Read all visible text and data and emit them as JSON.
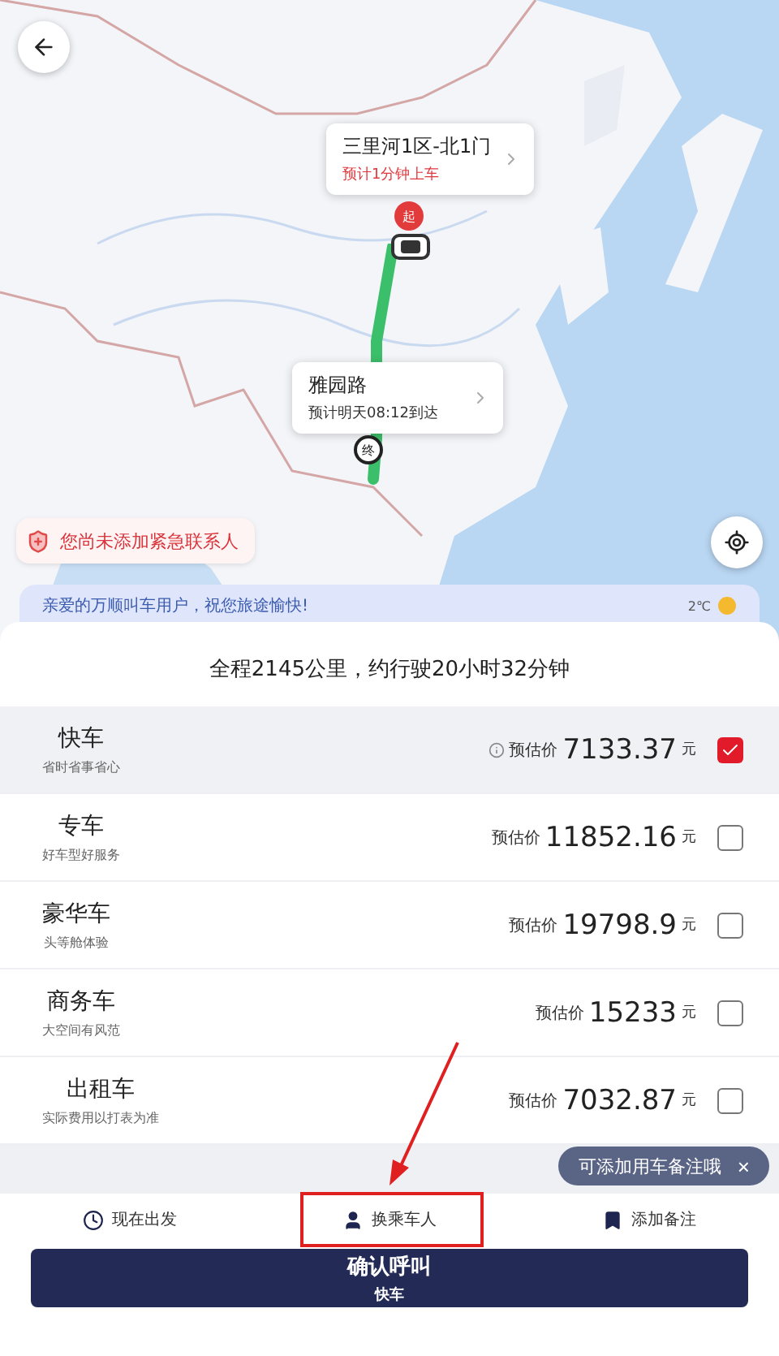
{
  "map": {
    "start_callout": {
      "title": "三里河1区-北1门",
      "subtitle": "预计1分钟上车",
      "marker": "起"
    },
    "end_callout": {
      "title": "雅园路",
      "subtitle": "预计明天08:12到达",
      "marker": "终"
    },
    "safety_chip": "您尚未添加紧急联系人"
  },
  "greeting_banner": {
    "text": "亲爱的万顺叫车用户，祝您旅途愉快!",
    "temperature": "2℃"
  },
  "summary": "全程2145公里，约行驶20小时32分钟",
  "car_types": [
    {
      "name": "快车",
      "tagline": "省时省事省心",
      "price_label": "预估价",
      "price": "7133.37",
      "unit": "元",
      "info": true,
      "selected": true
    },
    {
      "name": "专车",
      "tagline": "好车型好服务",
      "price_label": "预估价",
      "price": "11852.16",
      "unit": "元",
      "info": false,
      "selected": false
    },
    {
      "name": "豪华车",
      "tagline": "头等舱体验",
      "price_label": "预估价",
      "price": "19798.9",
      "unit": "元",
      "info": false,
      "selected": false
    },
    {
      "name": "商务车",
      "tagline": "大空间有风范",
      "price_label": "预估价",
      "price": "15233",
      "unit": "元",
      "info": false,
      "selected": false
    },
    {
      "name": "出租车",
      "tagline": "实际费用以打表为准",
      "price_label": "预估价",
      "price": "7032.87",
      "unit": "元",
      "info": false,
      "selected": false
    }
  ],
  "tooltip": {
    "text": "可添加用车备注哦",
    "close": "×"
  },
  "actions": [
    {
      "kind": "time",
      "label": "现在出发",
      "highlighted": false
    },
    {
      "kind": "passenger",
      "label": "换乘车人",
      "highlighted": true
    },
    {
      "kind": "note",
      "label": "添加备注",
      "highlighted": false
    }
  ],
  "confirm_button": {
    "label": "确认呼叫",
    "sublabel": "快车"
  }
}
